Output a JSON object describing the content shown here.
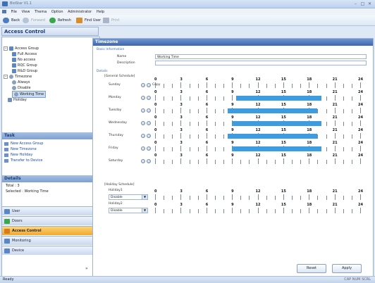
{
  "window": {
    "title": "BioStar V1.1",
    "minimize": "–",
    "maximize": "□",
    "close": "✕"
  },
  "menu": [
    "File",
    "View",
    "Thema",
    "Option",
    "Administrator",
    "Help"
  ],
  "toolbar": {
    "back": "Back",
    "forward": "Forward",
    "refresh": "Refresh",
    "find_user": "Find User",
    "print": "Print"
  },
  "left": {
    "title": "Access Control",
    "tree": {
      "access_group": "Access Group",
      "full_access": "Full Access",
      "no_access": "No access",
      "rqc_group": "RQC Group",
      "rd_group": "R&D Group",
      "timezone": "Timezone",
      "always": "Always",
      "disable": "Disable",
      "working_time": "Working Time",
      "holiday": "Holiday"
    },
    "task_title": "Task",
    "tasks": [
      "New Access Group",
      "New Timezone",
      "New Holiday",
      "Transfer to Device"
    ],
    "details_title": "Details",
    "total": "Total : 3",
    "selected": "Selected : Working Time",
    "nav": [
      "User",
      "Doors",
      "Access Control",
      "Monitoring",
      "Device"
    ]
  },
  "main": {
    "title": "Timezone",
    "basic_info": "Basic Information",
    "name_label": "Name",
    "name_value": "Working Time",
    "desc_label": "Description",
    "desc_value": "",
    "details": "Details",
    "general_schedule": "[General Schedule]",
    "copy": "Copy",
    "tick_labels": [
      "0",
      "3",
      "6",
      "9",
      "12",
      "15",
      "18",
      "21",
      "24"
    ],
    "days": [
      {
        "label": "Sunday",
        "start": 0,
        "end": 0
      },
      {
        "label": "Monday",
        "start": 9.5,
        "end": 19.5
      },
      {
        "label": "Tuesday",
        "start": 8.5,
        "end": 19
      },
      {
        "label": "Wednesday",
        "start": 9,
        "end": 19.5
      },
      {
        "label": "Thursday",
        "start": 8.5,
        "end": 19
      },
      {
        "label": "Friday",
        "start": 9,
        "end": 19.5
      },
      {
        "label": "Saturday",
        "start": 0,
        "end": 0
      }
    ],
    "holiday_schedule": "[Holiday Schedule]",
    "holiday1": "Holiday1",
    "holiday2": "Holiday2",
    "holiday1_value": "Disable",
    "holiday2_value": "Disable",
    "reset": "Reset",
    "apply": "Apply"
  },
  "status": {
    "text": "Ready",
    "right": "CAP NUM SCRL"
  }
}
